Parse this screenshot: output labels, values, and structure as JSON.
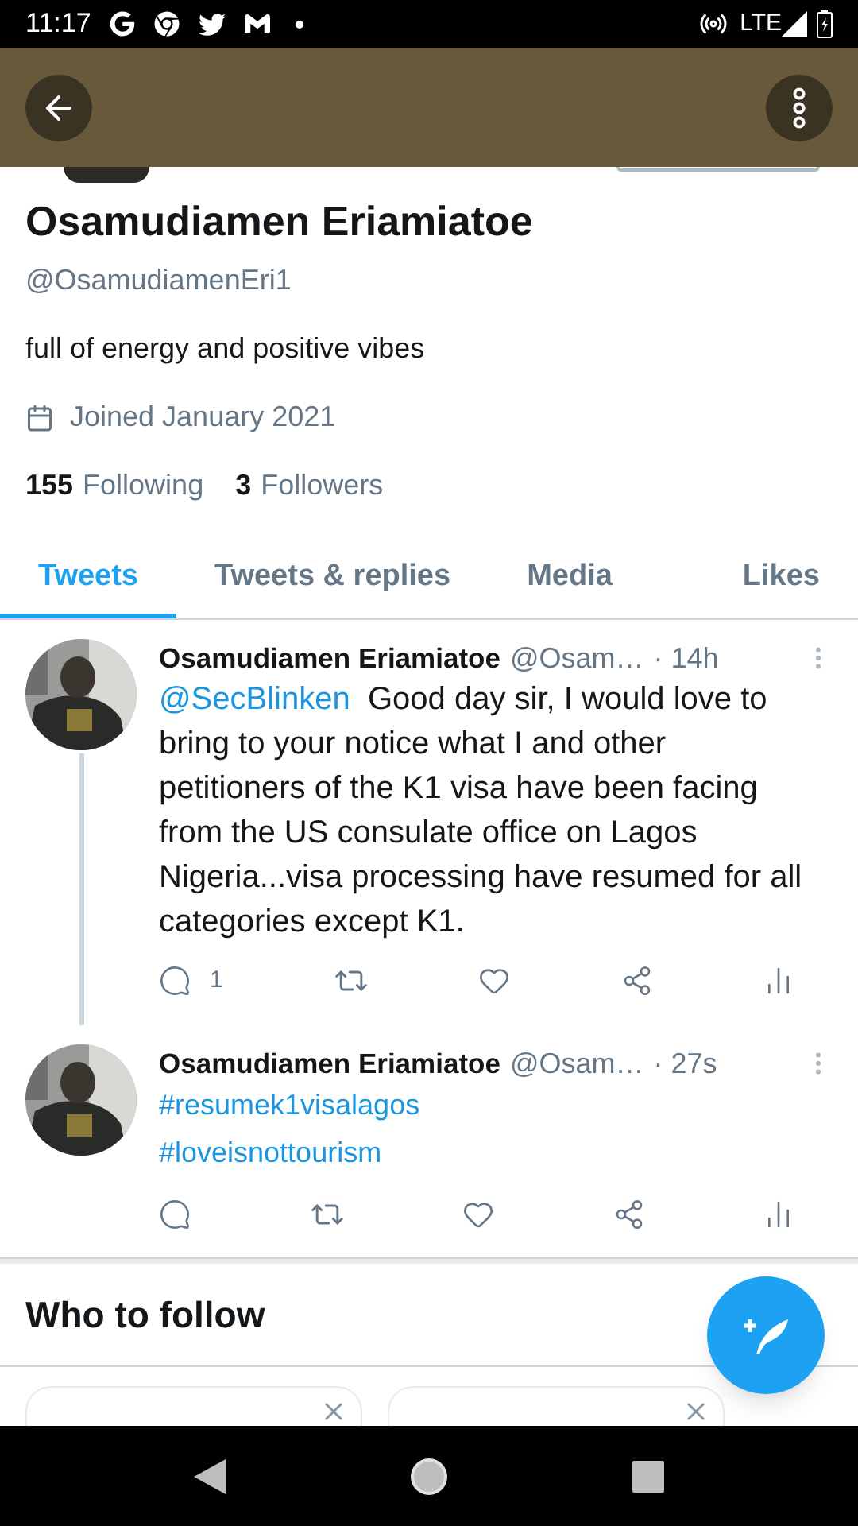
{
  "status_bar": {
    "time": "11:17",
    "network": "LTE"
  },
  "profile": {
    "name": "Osamudiamen Eriamiatoe",
    "handle": "@OsamudiamenEri1",
    "bio": "full of energy and positive vibes",
    "joined": "Joined January 2021",
    "following_count": "155",
    "following_label": "Following",
    "followers_count": "3",
    "followers_label": "Followers"
  },
  "tabs": [
    {
      "label": "Tweets",
      "selected": true
    },
    {
      "label": "Tweets & replies",
      "selected": false
    },
    {
      "label": "Media",
      "selected": false
    },
    {
      "label": "Likes",
      "selected": false
    }
  ],
  "tweets": [
    {
      "name": "Osamudiamen Eriamiatoe",
      "handle": "@Osam…",
      "time": "· 14h",
      "thread": true,
      "segments": [
        {
          "kind": "mention",
          "text": "@SecBlinken"
        },
        {
          "kind": "text",
          "text": "Good day sir, I would love to bring to your notice what I and other petitioners of the K1 visa have been facing from the US consulate office on Lagos Nigeria...visa processing have resumed for all categories except K1."
        }
      ],
      "reply_count": "1"
    },
    {
      "name": "Osamudiamen Eriamiatoe",
      "handle": "@Osam…",
      "time": "· 27s",
      "thread": false,
      "segments": [
        {
          "kind": "hashtag",
          "text": "#resumek1visalagos"
        },
        {
          "kind": "hashtag",
          "text": "#loveisnottourism"
        }
      ]
    }
  ],
  "who_to_follow": {
    "title": "Who to follow"
  }
}
